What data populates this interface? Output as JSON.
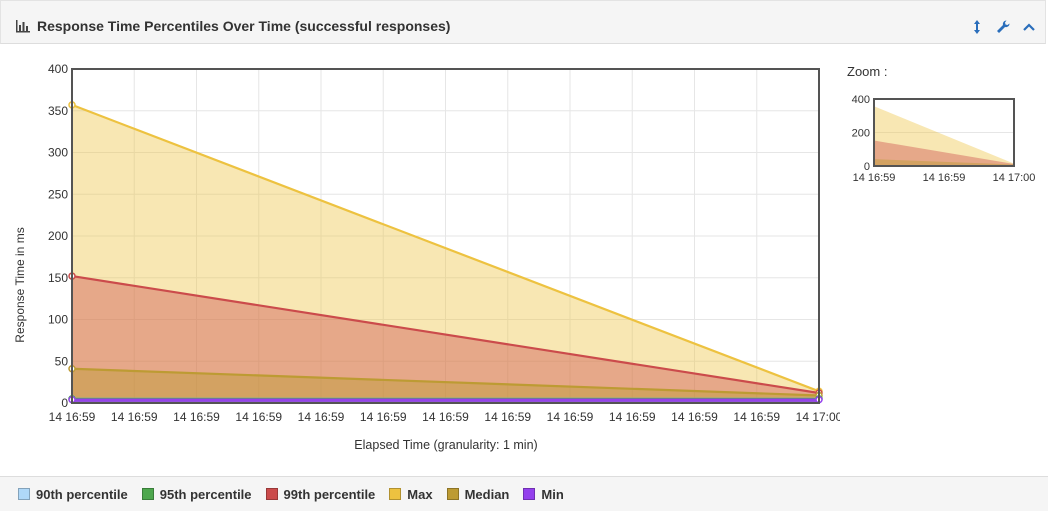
{
  "panel": {
    "title": "Response Time Percentiles Over Time (successful responses)",
    "icons": {
      "title": "bar-chart-icon",
      "expand": "expand-vertical-icon",
      "settings": "wrench-icon",
      "collapse": "chevron-up-icon"
    }
  },
  "chart_data": {
    "type": "area",
    "xlabel": "Elapsed Time (granularity: 1 min)",
    "ylabel": "Response Time in ms",
    "ylim": [
      0,
      400
    ],
    "yticks": [
      0,
      50,
      100,
      150,
      200,
      250,
      300,
      350,
      400
    ],
    "xtick_labels": [
      "14 16:59",
      "14 16:59",
      "14 16:59",
      "14 16:59",
      "14 16:59",
      "14 16:59",
      "14 16:59",
      "14 16:59",
      "14 16:59",
      "14 16:59",
      "14 16:59",
      "14 16:59",
      "14 17:00"
    ],
    "x": [
      "14 16:59",
      "14 17:00"
    ],
    "grid": true,
    "legend_position": "bottom",
    "series": [
      {
        "name": "90th percentile",
        "color": "#afd8f8",
        "values": [
          5,
          5
        ]
      },
      {
        "name": "95th percentile",
        "color": "#4da74d",
        "values": [
          5,
          5
        ]
      },
      {
        "name": "99th percentile",
        "color": "#cb4b4b",
        "values": [
          152,
          12
        ]
      },
      {
        "name": "Max",
        "color": "#edc240",
        "values": [
          357,
          14
        ]
      },
      {
        "name": "Median",
        "color": "#bd9b33",
        "values": [
          41,
          9
        ]
      },
      {
        "name": "Min",
        "color": "#9440ed",
        "values": [
          4,
          4
        ]
      }
    ]
  },
  "zoom": {
    "label": "Zoom :",
    "yticks": [
      0,
      200,
      400
    ],
    "xtick_labels": [
      "14 16:59",
      "14 16:59",
      "14 17:00"
    ]
  }
}
